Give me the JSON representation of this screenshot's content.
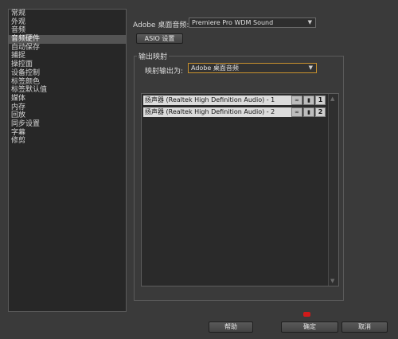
{
  "sidebar": {
    "items": [
      {
        "label": "常规",
        "selected": false
      },
      {
        "label": "外观",
        "selected": false
      },
      {
        "label": "音频",
        "selected": false
      },
      {
        "label": "音频硬件",
        "selected": true
      },
      {
        "label": "自动保存",
        "selected": false
      },
      {
        "label": "捕捉",
        "selected": false
      },
      {
        "label": "操控面",
        "selected": false
      },
      {
        "label": "设备控制",
        "selected": false
      },
      {
        "label": "标签颜色",
        "selected": false
      },
      {
        "label": "标签默认值",
        "selected": false
      },
      {
        "label": "媒体",
        "selected": false
      },
      {
        "label": "内存",
        "selected": false
      },
      {
        "label": "回放",
        "selected": false
      },
      {
        "label": "同步设置",
        "selected": false
      },
      {
        "label": "字幕",
        "selected": false
      },
      {
        "label": "修剪",
        "selected": false
      }
    ]
  },
  "device": {
    "label": "Adobe 桌面音频:",
    "value": "Premiere Pro WDM Sound"
  },
  "asio_button": "ASIO 设置",
  "output_group": {
    "title": "输出映射",
    "map_label": "映射输出为:",
    "map_value": "Adobe 桌面音频"
  },
  "channels": [
    {
      "label": "扬声器 (Realtek High Definition Audio) - 1",
      "number": "1"
    },
    {
      "label": "扬声器 (Realtek High Definition Audio) - 2",
      "number": "2"
    }
  ],
  "buttons": {
    "help": "帮助",
    "ok": "确定",
    "cancel": "取消"
  },
  "colors": {
    "accent_border": "#c8912e",
    "selected_item": "#545454"
  }
}
